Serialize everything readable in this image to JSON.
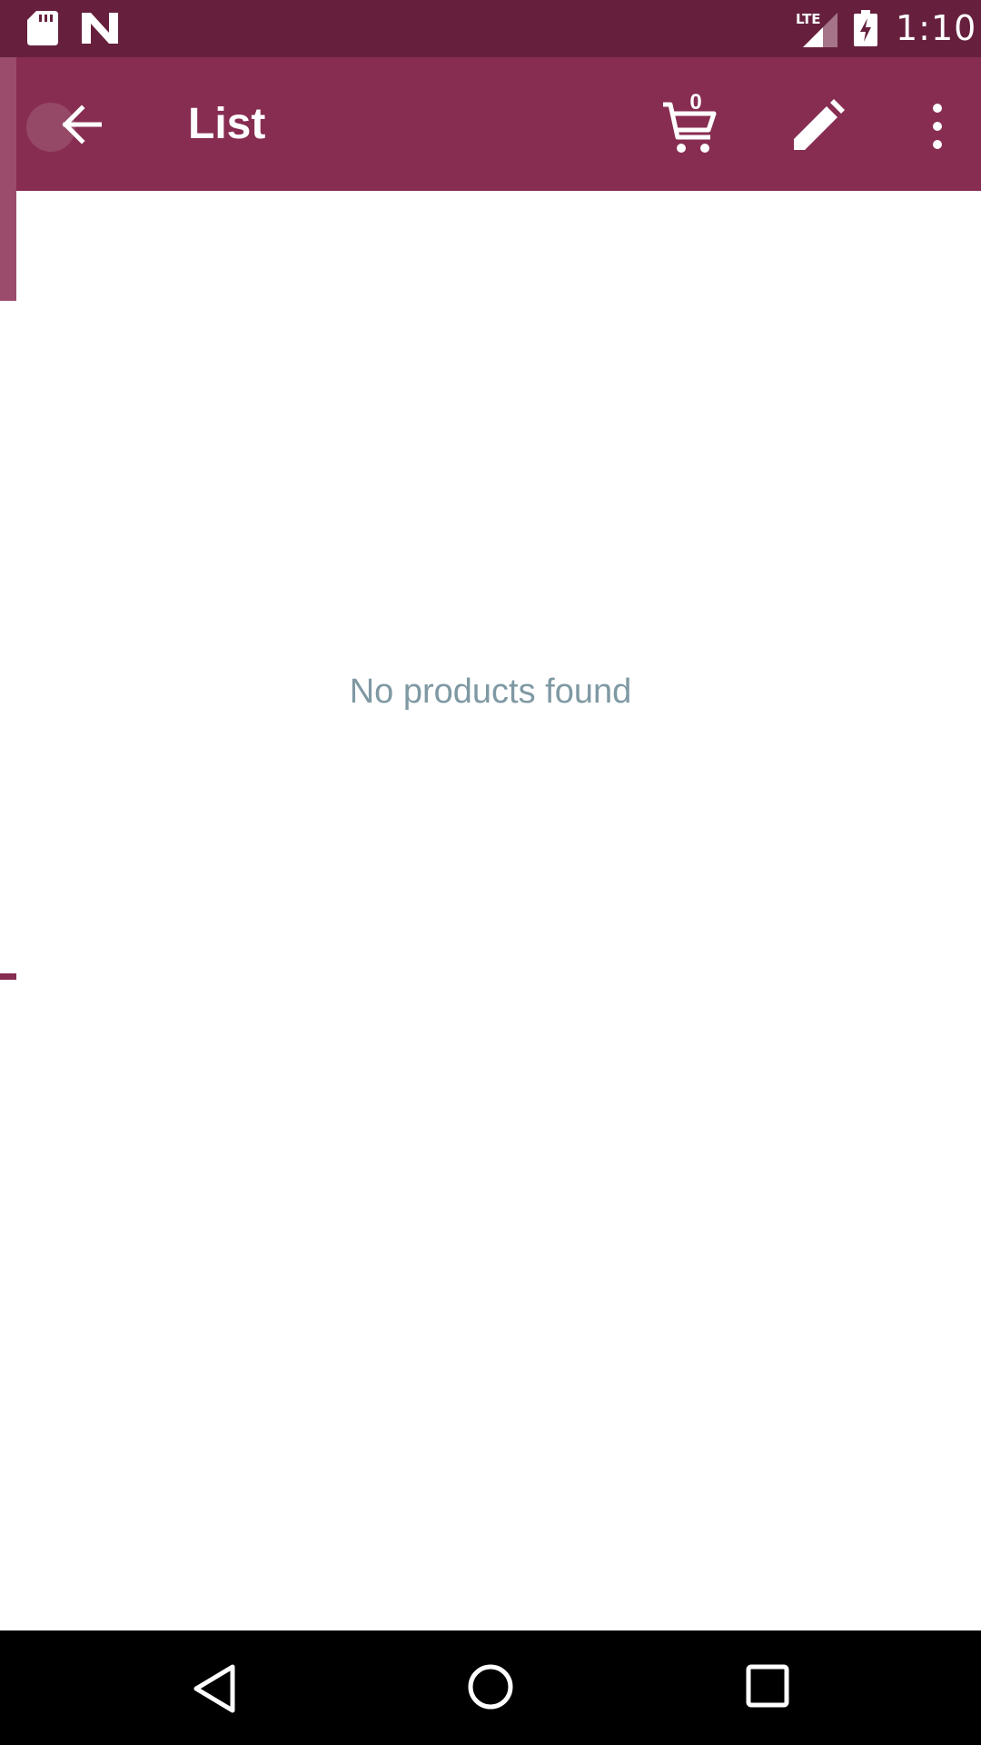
{
  "status_bar": {
    "time": "1:10",
    "network_label": "LTE",
    "icons": [
      "sd-card-icon",
      "n-notification-icon",
      "lte-signal-icon",
      "battery-charging-icon"
    ]
  },
  "app_bar": {
    "title": "List",
    "cart_count": "0",
    "icons": [
      "back-arrow-icon",
      "cart-icon",
      "edit-pencil-icon",
      "more-vertical-icon"
    ],
    "colors": {
      "primary": "#872d51",
      "status_bar": "#66203d"
    }
  },
  "content": {
    "empty_message": "No products found",
    "empty_message_color": "#7f99a3"
  },
  "nav_bar": {
    "icons": [
      "nav-back-icon",
      "nav-home-icon",
      "nav-recent-icon"
    ]
  }
}
